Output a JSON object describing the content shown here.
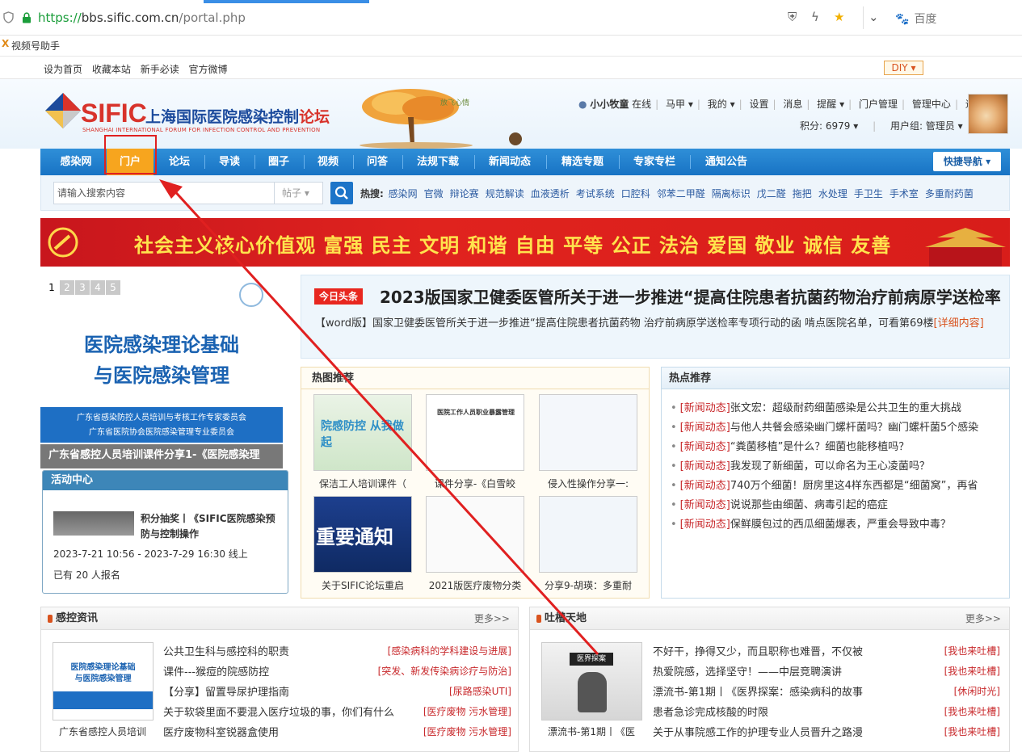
{
  "browser": {
    "url_scheme": "https://",
    "url_host": "bbs.sific.com.cn",
    "url_path": "/portal.php",
    "search_engine": "百度",
    "bookmark": "视频号助手"
  },
  "topbar": {
    "links": [
      "设为首页",
      "收藏本站",
      "新手必读",
      "官方微博"
    ],
    "diy": "DIY"
  },
  "header": {
    "logo_sific": "SIFIC",
    "logo_cn_a": "上海国际医院感染控制",
    "logo_cn_b": "论坛",
    "logo_en": "SHANGHAI INTERNATIONAL FORUM FOR INFECTION CONTROL AND PREVENTION",
    "tree_text": "放飞心情"
  },
  "user": {
    "name": "小小牧童",
    "status": "在线",
    "menu": [
      "马甲",
      "我的",
      "设置",
      "消息",
      "提醒",
      "门户管理",
      "管理中心",
      "退出"
    ],
    "points": "积分: 6979",
    "group": "用户组: 管理员"
  },
  "nav": {
    "items": [
      "感染网",
      "门户",
      "论坛",
      "导读",
      "圈子",
      "视频",
      "问答",
      "法规下载",
      "新闻动态",
      "精选专题",
      "专家专栏",
      "通知公告"
    ],
    "quick": "快捷导航"
  },
  "search": {
    "placeholder": "请输入搜索内容",
    "type": "帖子",
    "hot_label": "热搜:",
    "hot": [
      "感染网",
      "官微",
      "辩论赛",
      "规范解读",
      "血液透析",
      "考试系统",
      "口腔科",
      "邻苯二甲醛",
      "隔离标识",
      "戊二醛",
      "拖把",
      "水处理",
      "手卫生",
      "手术室",
      "多重耐药菌"
    ]
  },
  "banner": {
    "text": "社会主义核心价值观  富强 民主 文明 和谐 自由 平等 公正 法治 爱国 敬业 诚信 友善"
  },
  "slider": {
    "pages": [
      "1",
      "2",
      "3",
      "4",
      "5"
    ],
    "title1": "医院感染理论基础",
    "title2": "与医院感染管理",
    "org1": "广东省感染防控人员培训与考核工作专家委员会",
    "org2": "广东省医院协会医院感染管理专业委员会",
    "caption": "广东省感控人员培训课件分享1-《医院感染理"
  },
  "activity": {
    "header": "活动中心",
    "title1": "积分抽奖丨《SIFIC医院感染预",
    "title2": "防与控制操作",
    "date": "2023-7-21 10:56 - 2023-7-29 16:30 线上",
    "signup": "已有 20 人报名"
  },
  "headline": {
    "tag": "今日头条",
    "title": "2023版国家卫健委医管所关于进一步推进“提高住院患者抗菌药物治疗前病原学送检率",
    "desc": "【word版】国家卫健委医管所关于进一步推进“提高住院患者抗菌药物 治疗前病原学送检率专项行动的函 啃点医院名单，可看第69楼",
    "more": "[详细内容]"
  },
  "pics": {
    "header": "热图推荐",
    "items": [
      {
        "caption": "保洁工人培训课件（",
        "text": "院感防控 从我做起"
      },
      {
        "caption": "课件分享-《白雪皎",
        "text": "医院工作人员职业暴露管理"
      },
      {
        "caption": "侵入性操作分享一:",
        "text": ""
      },
      {
        "caption": "关于SIFIC论坛重启",
        "text": "重要通知"
      },
      {
        "caption": "2021版医疗废物分类",
        "text": ""
      },
      {
        "caption": "分享9-胡瑛：多重耐",
        "text": ""
      }
    ]
  },
  "recs": {
    "header": "热点推荐",
    "items": [
      {
        "cat": "[新闻动态]",
        "title": "张文宏：超级耐药细菌感染是公共卫生的重大挑战"
      },
      {
        "cat": "[新闻动态]",
        "title": "与他人共餐会感染幽门螺杆菌吗？幽门螺杆菌5个感染"
      },
      {
        "cat": "[新闻动态]",
        "title": "“粪菌移植”是什么？细菌也能移植吗？"
      },
      {
        "cat": "[新闻动态]",
        "title": "我发现了新细菌，可以命名为王心凌菌吗？"
      },
      {
        "cat": "[新闻动态]",
        "title": "740万个细菌！厨房里这4样东西都是“细菌窝”，再省"
      },
      {
        "cat": "[新闻动态]",
        "title": "说说那些由细菌、病毒引起的癌症"
      },
      {
        "cat": "[新闻动态]",
        "title": "保鲜膜包过的西瓜细菌爆表，严重会导致中毒？"
      }
    ]
  },
  "news": {
    "header": "感控资讯",
    "more": "更多>>",
    "thumb_caption": "广东省感控人员培训",
    "thumb_title1": "医院感染理论基础",
    "thumb_title2": "与医院感染管理",
    "items": [
      {
        "title": "公共卫生科与感控科的职责",
        "tag": "[感染病科的学科建设与进展]"
      },
      {
        "title": "课件---猴痘的院感防控",
        "tag": "[突发、新发传染病诊疗与防治]"
      },
      {
        "title": "【分享】留置导尿护理指南",
        "tag": "[尿路感染UTI]"
      },
      {
        "title": "关于软袋里面不要混入医疗垃圾的事，你们有什么",
        "tag": "[医疗废物 污水管理]"
      },
      {
        "title": "医疗废物科室锐器盒使用",
        "tag": "[医疗废物 污水管理]"
      }
    ]
  },
  "talk": {
    "header": "吐槽天地",
    "more": "更多>>",
    "thumb_caption": "漂流书-第1期丨《医",
    "thumb_title": "医界探案",
    "items": [
      {
        "title": "不好干，挣得又少，而且职称也难晋，不仅被",
        "tag": "[我也来吐槽]"
      },
      {
        "title": "热爱院感，选择坚守！——中层竞聘演讲",
        "tag": "[我也来吐槽]"
      },
      {
        "title": "漂流书-第1期丨《医界探案：感染病科的故事",
        "tag": "[休闲时光]"
      },
      {
        "title": "患者急诊完成核酸的时限",
        "tag": "[我也来吐槽]"
      },
      {
        "title": "关于从事院感工作的护理专业人员晋升之路漫",
        "tag": "[我也来吐槽]"
      }
    ]
  },
  "colors": {
    "nav_blue": "#1e7ccd",
    "active_orange": "#f7a51e",
    "annotation_red": "#e02020",
    "category_red": "#c8282b"
  }
}
